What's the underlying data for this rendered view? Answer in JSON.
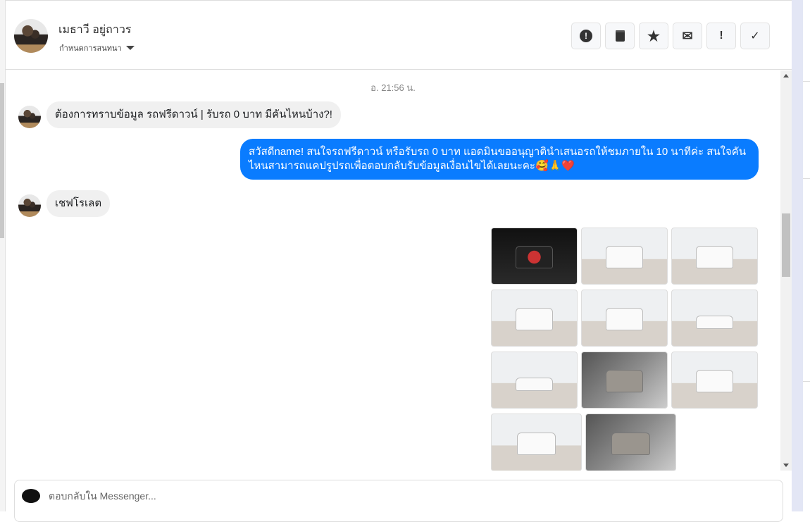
{
  "header": {
    "name": "เมธาวี อยู่ถาวร",
    "assign_label": "กำหนดการสนทนา"
  },
  "actions": [
    {
      "icon": "alert-circle-icon",
      "glyph": "!"
    },
    {
      "icon": "trash-icon",
      "glyph": "🗑"
    },
    {
      "icon": "star-icon",
      "glyph": "★"
    },
    {
      "icon": "envelope-icon",
      "glyph": "✉"
    },
    {
      "icon": "exclamation-icon",
      "glyph": "!"
    },
    {
      "icon": "check-icon",
      "glyph": "✓"
    }
  ],
  "conversation": {
    "timestamp": "อ. 21:56 น.",
    "messages": [
      {
        "from": "customer",
        "text": "ต้องการทราบข้อมูล รถฟรีดาวน์ | รับรถ 0 บาท มีคันไหนบ้าง?!"
      },
      {
        "from": "page",
        "text": "สวัสดีname! สนใจรถฟรีดาวน์ หรือรับรถ 0 บาท แอดมินขออนุญาตินำเสนอรถให้ชมภายใน 10 นาทีค่ะ สนใจคันไหนสามารถแคปรูปรถเพื่อตอบกลับรับข้อมูลเงื่อนไขได้เลยนะคะ🥰🙏❤️"
      },
      {
        "from": "customer",
        "text": "เชฟโรเลต"
      }
    ],
    "photos_count": 11
  },
  "composer": {
    "placeholder": "ตอบกลับใน Messenger..."
  }
}
